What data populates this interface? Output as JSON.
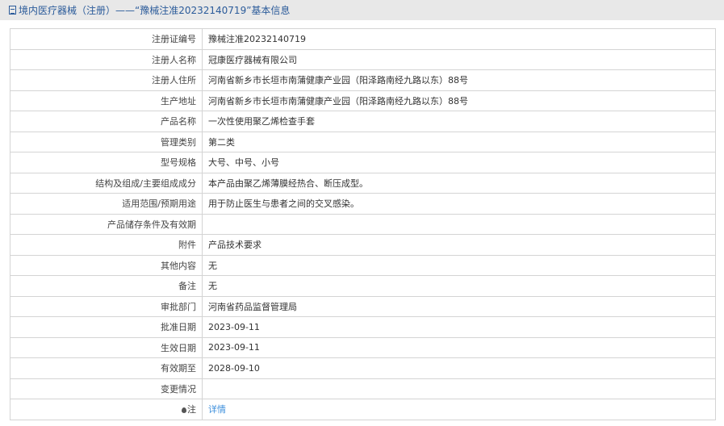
{
  "header": {
    "title": "境内医疗器械（注册）——“豫械注准20232140719”基本信息"
  },
  "rows": [
    {
      "label": "注册证编号",
      "value": "豫械注准20232140719"
    },
    {
      "label": "注册人名称",
      "value": "冠康医疗器械有限公司"
    },
    {
      "label": "注册人住所",
      "value": "河南省新乡市长垣市南蒲健康产业园（阳泽路南经九路以东）88号"
    },
    {
      "label": "生产地址",
      "value": "河南省新乡市长垣市南蒲健康产业园（阳泽路南经九路以东）88号"
    },
    {
      "label": "产品名称",
      "value": "一次性使用聚乙烯检查手套"
    },
    {
      "label": "管理类别",
      "value": "第二类"
    },
    {
      "label": "型号规格",
      "value": "大号、中号、小号"
    },
    {
      "label": "结构及组成/主要组成成分",
      "value": "本产品由聚乙烯薄膜经热合、断压成型。"
    },
    {
      "label": "适用范围/预期用途",
      "value": "用于防止医生与患者之间的交叉感染。"
    },
    {
      "label": "产品储存条件及有效期",
      "value": ""
    },
    {
      "label": "附件",
      "value": "产品技术要求"
    },
    {
      "label": "其他内容",
      "value": "无"
    },
    {
      "label": "备注",
      "value": "无"
    },
    {
      "label": "审批部门",
      "value": "河南省药品监督管理局"
    },
    {
      "label": "批准日期",
      "value": "2023-09-11"
    },
    {
      "label": "生效日期",
      "value": "2023-09-11"
    },
    {
      "label": "有效期至",
      "value": "2028-09-10"
    },
    {
      "label": "变更情况",
      "value": ""
    }
  ],
  "note": {
    "label": "注",
    "link": "详情"
  }
}
